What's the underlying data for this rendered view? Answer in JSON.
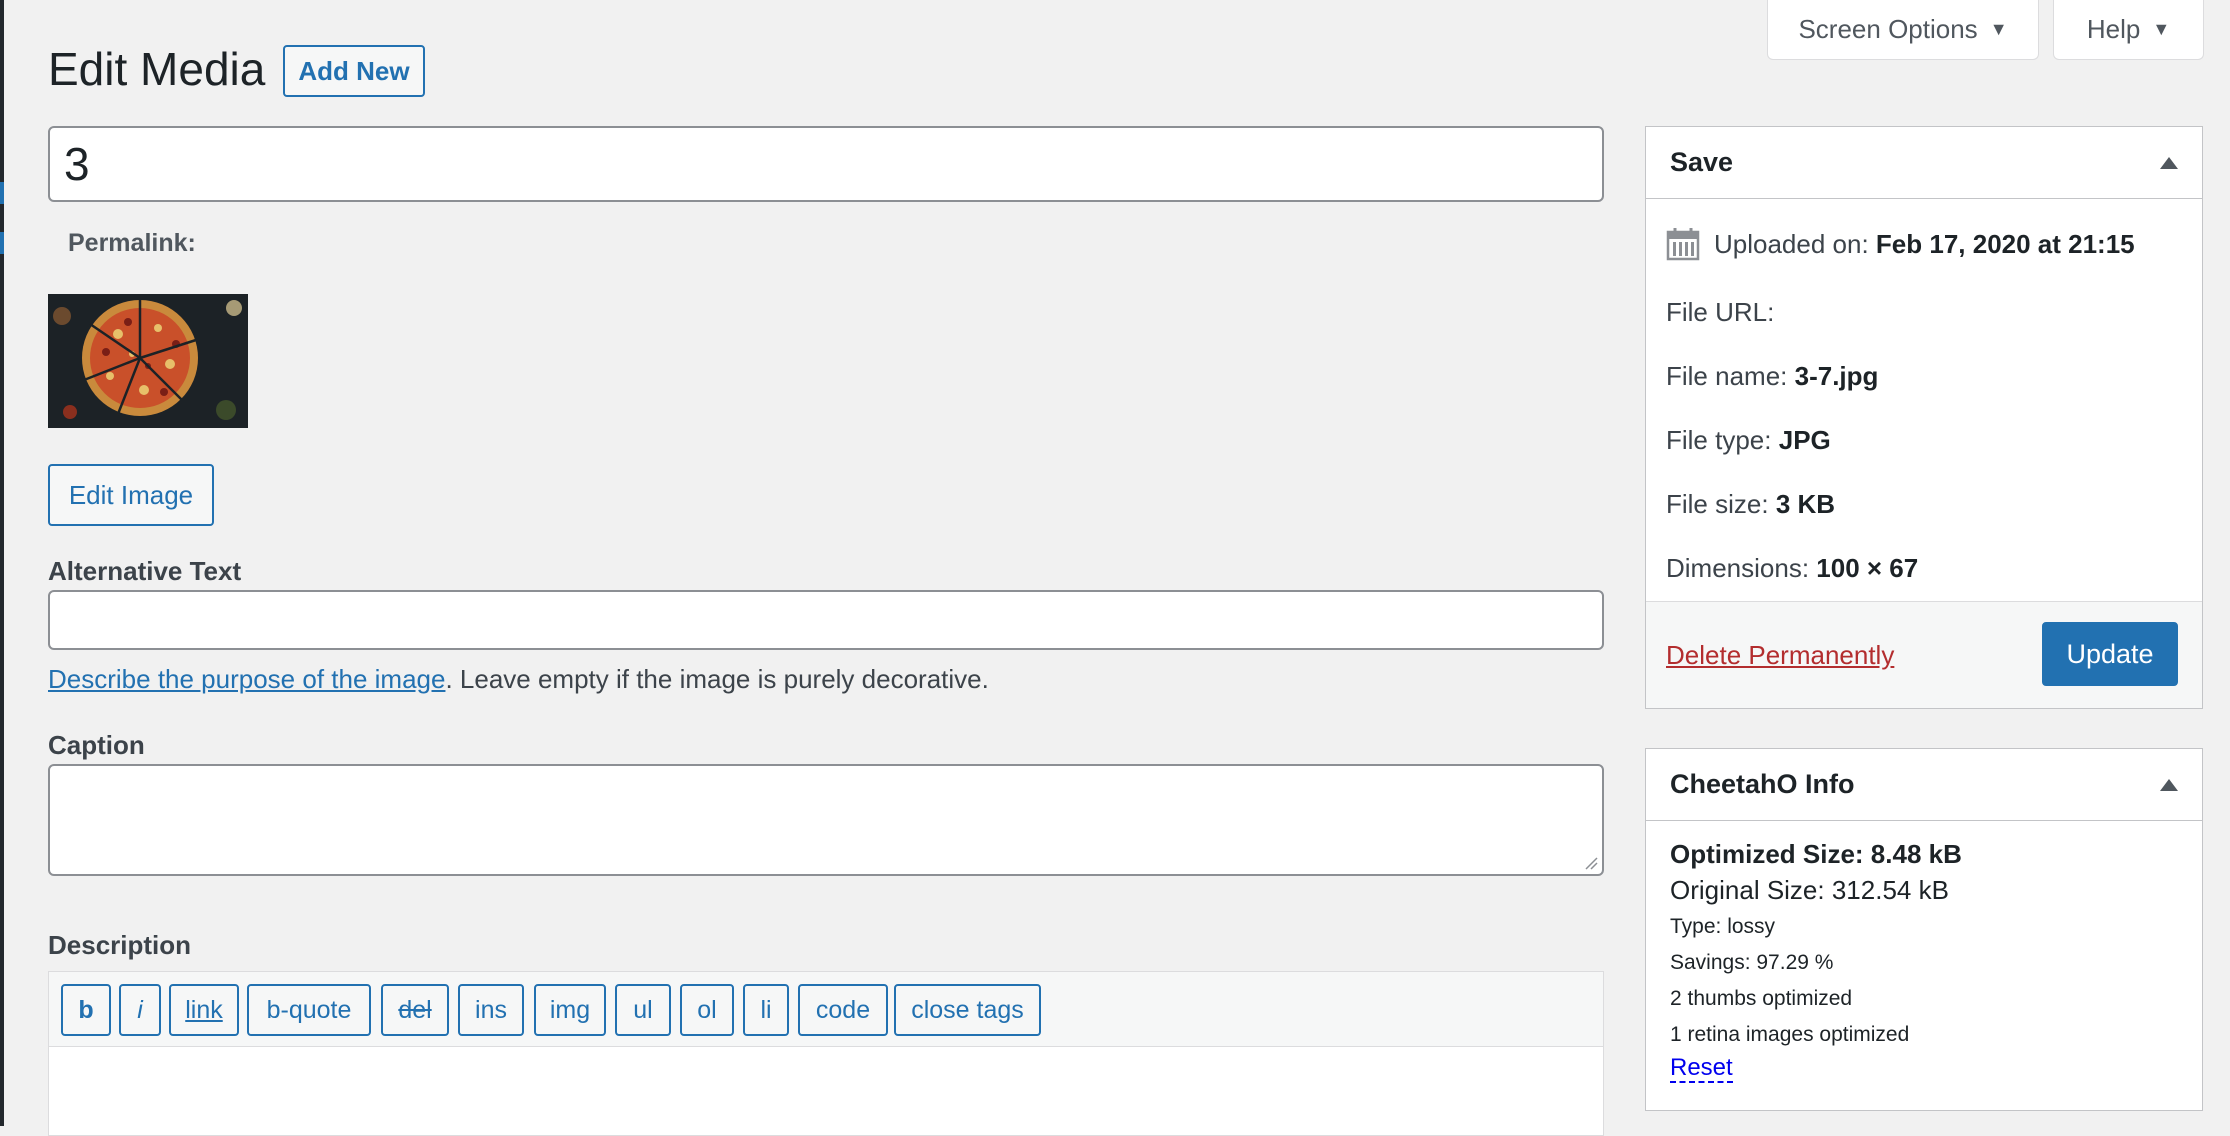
{
  "header": {
    "title": "Edit Media",
    "add_new_label": "Add New",
    "screen_options_label": "Screen Options",
    "help_label": "Help"
  },
  "title_field": {
    "value": "3"
  },
  "permalink": {
    "label": "Permalink:"
  },
  "thumbnail": {
    "icon": "pizza-image"
  },
  "edit_image_label": "Edit Image",
  "alt_text": {
    "label": "Alternative Text",
    "value": "",
    "help_link": "Describe the purpose of the image",
    "help_suffix": ". Leave empty if the image is purely decorative."
  },
  "caption": {
    "label": "Caption",
    "value": ""
  },
  "description": {
    "label": "Description",
    "toolbar": [
      "b",
      "i",
      "link",
      "b-quote",
      "del",
      "ins",
      "img",
      "ul",
      "ol",
      "li",
      "code",
      "close tags"
    ]
  },
  "save_box": {
    "title": "Save",
    "uploaded_label": "Uploaded on:",
    "uploaded_value": "Feb 17, 2020 at 21:15",
    "file_url_label": "File URL:",
    "file_name_label": "File name:",
    "file_name_value": "3-7.jpg",
    "file_type_label": "File type:",
    "file_type_value": "JPG",
    "file_size_label": "File size:",
    "file_size_value": "3 KB",
    "dimensions_label": "Dimensions:",
    "dimensions_value": "100 × 67",
    "delete_label": "Delete Permanently",
    "update_label": "Update"
  },
  "cheetah_box": {
    "title": "CheetahO Info",
    "optimized_size": "Optimized Size: 8.48 kB",
    "original_size": "Original Size: 312.54 kB",
    "type": "Type: lossy",
    "savings": "Savings: 97.29 %",
    "thumbs": "2 thumbs optimized",
    "retina": "1 retina images optimized",
    "reset_label": "Reset"
  },
  "colors": {
    "accent": "#2271b1",
    "danger": "#b32d2e",
    "background": "#f1f1f1"
  }
}
